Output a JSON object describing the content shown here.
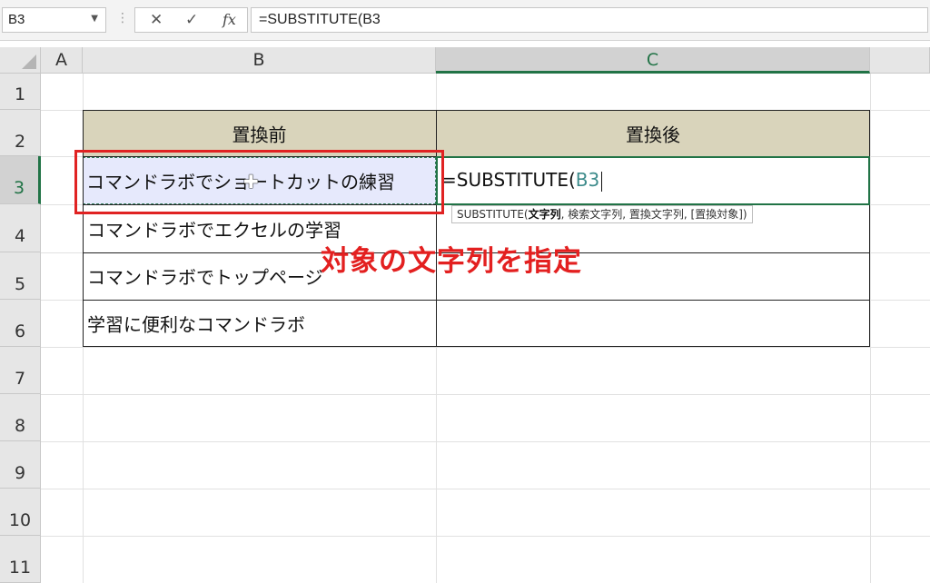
{
  "formula_bar": {
    "name_box": "B3",
    "name_box_arrow": "▼",
    "dots": "⋮",
    "cancel": "✕",
    "enter": "✓",
    "fx": "fx",
    "formula": "=SUBSTITUTE(B3"
  },
  "columns": [
    "A",
    "B",
    "C"
  ],
  "rows": [
    "1",
    "2",
    "3",
    "4",
    "5",
    "6",
    "7",
    "8",
    "9",
    "10",
    "11"
  ],
  "table": {
    "header_b": "置換前",
    "header_c": "置換後",
    "b3": "コマンドラボでショートカットの練習",
    "b4": "コマンドラボでエクセルの学習",
    "b5": "コマンドラボでトップページ",
    "b6": "学習に便利なコマンドラボ"
  },
  "editing": {
    "prefix": "=SUBSTITUTE(",
    "ref": "B3"
  },
  "tooltip": {
    "func": "SUBSTITUTE(",
    "arg1": "文字列",
    "rest": ", 検索文字列, 置換文字列, [置換対象])"
  },
  "annotation": "対象の文字列を指定",
  "colors": {
    "accent_green": "#217346",
    "header_fill": "#d9d4bb",
    "selection_fill": "#e6e9fc",
    "annotation_red": "#e32020"
  },
  "icons": {
    "cursor": "plus-cursor-icon"
  }
}
